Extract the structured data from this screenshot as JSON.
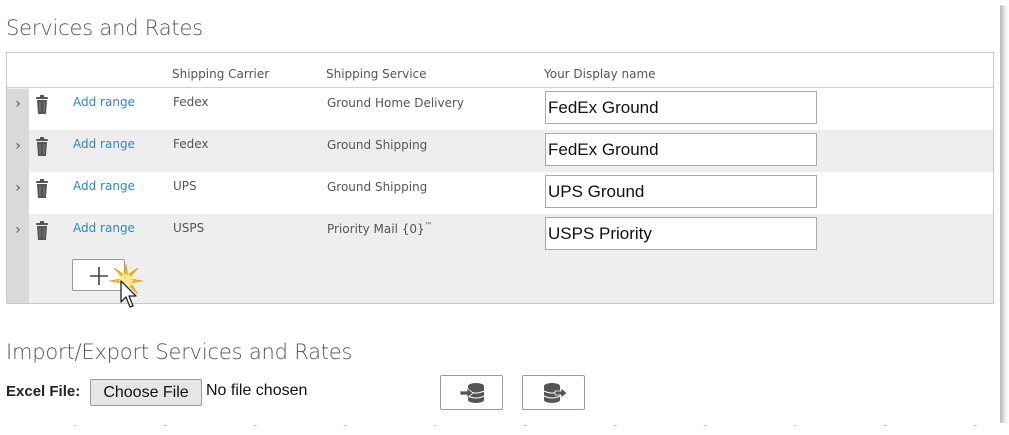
{
  "section_title": "Services and Rates",
  "table": {
    "headers": {
      "carrier": "Shipping Carrier",
      "service": "Shipping Service",
      "display_name": "Your Display name"
    },
    "rows": [
      {
        "action": "Add range",
        "carrier": "Fedex",
        "service": "Ground Home Delivery",
        "service_sup": "",
        "display_name": "FedEx Ground"
      },
      {
        "action": "Add range",
        "carrier": "Fedex",
        "service": "Ground Shipping",
        "service_sup": "",
        "display_name": "FedEx Ground"
      },
      {
        "action": "Add range",
        "carrier": "UPS",
        "service": "Ground Shipping",
        "service_sup": "",
        "display_name": "UPS Ground"
      },
      {
        "action": "Add range",
        "carrier": "USPS",
        "service": "Priority Mail {0}",
        "service_sup": "™",
        "display_name": "USPS Priority"
      }
    ],
    "add_button_icon": "plus-icon"
  },
  "import_export": {
    "title": "Import/Export Services and Rates",
    "file_label": "Excel File:",
    "choose_file_label": "Choose File",
    "file_status": "No file chosen",
    "import_icon": "import-database-icon",
    "export_icon": "export-database-icon"
  },
  "colors": {
    "link": "#2a8ac4",
    "header_bg": "#ffffff",
    "alt_row_bg": "#eeeeee",
    "strip_bg": "#d9d9d9"
  }
}
